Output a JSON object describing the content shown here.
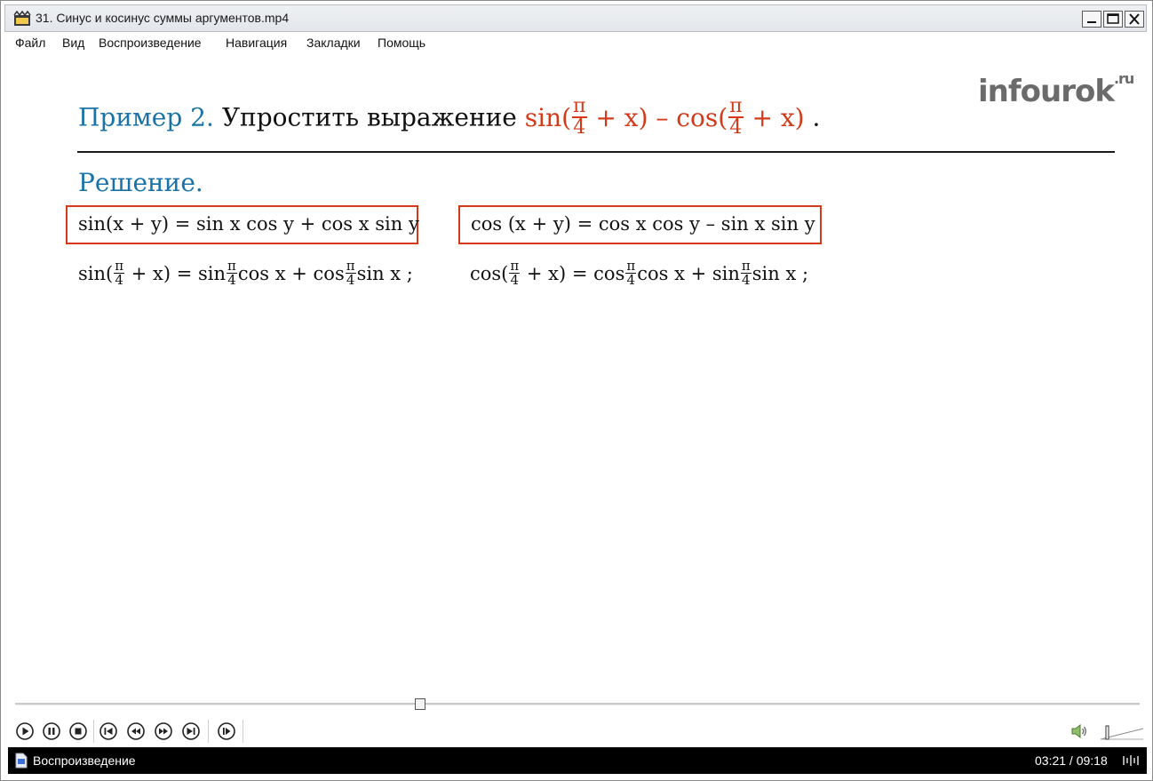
{
  "window": {
    "title": "31. Синус и косинус суммы аргументов.mp4"
  },
  "menu": {
    "items": [
      {
        "label": "Файл"
      },
      {
        "label": "Вид"
      },
      {
        "label": "Воспроизведение"
      },
      {
        "label": "Навигация"
      },
      {
        "label": "Закладки"
      },
      {
        "label": "Помощь"
      }
    ]
  },
  "slide": {
    "logo": {
      "main": "infourok",
      "suffix": ".ru"
    },
    "heading": {
      "prefix": "Пример 2.",
      "task": "Упростить выражение",
      "expr_sin": "sin(",
      "pi": "π",
      "four": "4",
      "plus_x_minus": " + x) – cos(",
      "plus_x_close": " + x)",
      "period": " ."
    },
    "solution_label": "Решение.",
    "formula_sin": "sin(x + y) = sin x cos y + cos x sin y",
    "formula_cos": "cos (x + y) = cos x cos y  – sin x sin y",
    "expand_sin": {
      "p1": "sin(",
      "p2": " + x) = sin",
      "p3": "cos x + cos",
      "p4": "sin x ;"
    },
    "expand_cos": {
      "p1": "cos(",
      "p2": " + x) = cos",
      "p3": "cos x + sin",
      "p4": "sin x ;"
    }
  },
  "player": {
    "position_fraction": 0.36,
    "status": "Воспроизведение",
    "time": "03:21 / 09:18",
    "buttons": [
      "play",
      "pause",
      "stop",
      "previous",
      "rewind",
      "fast-forward",
      "next",
      "frame-step"
    ]
  }
}
